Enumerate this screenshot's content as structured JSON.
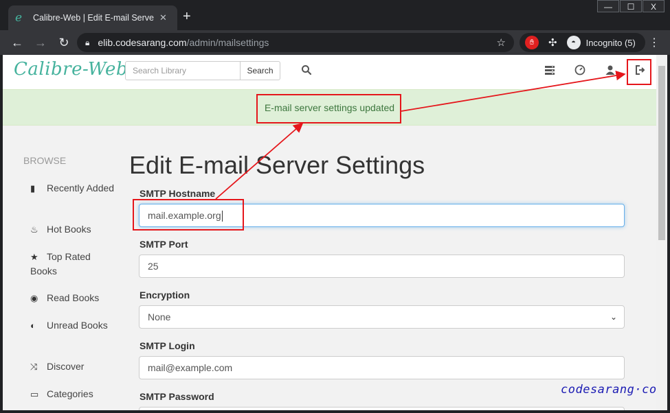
{
  "browser": {
    "tab_title": "Calibre-Web | Edit E-mail Server S",
    "tab_favicon": "e",
    "tab_close": "✕",
    "new_tab": "+",
    "url_host": "elib.codesarang.com",
    "url_path": "/admin/mailsettings",
    "incognito_label": "Incognito (5)",
    "window_controls": [
      "—",
      "☐",
      "X"
    ]
  },
  "navbar": {
    "brand": "Calibre-Web",
    "search_placeholder": "Search Library",
    "search_button": "Search",
    "icons": [
      "search-icon",
      "tasks-icon",
      "dashboard-icon",
      "user-icon",
      "logout-icon"
    ]
  },
  "alert": {
    "message": "E-mail server settings updated"
  },
  "sidebar": {
    "title": "BROWSE",
    "items": [
      {
        "label": "Recently Added",
        "icon": "book-icon",
        "glyph": "▮"
      },
      {
        "label": "Hot Books",
        "icon": "fire-icon",
        "glyph": "♨"
      },
      {
        "label": "Top Rated Books",
        "icon": "star-icon",
        "glyph": "★"
      },
      {
        "label": "Read Books",
        "icon": "eye-icon",
        "glyph": "◉"
      },
      {
        "label": "Unread Books",
        "icon": "eye-slash-icon",
        "glyph": "◐"
      },
      {
        "label": "Discover",
        "icon": "shuffle-icon",
        "glyph": "⤨"
      },
      {
        "label": "Categories",
        "icon": "inbox-icon",
        "glyph": "▭"
      }
    ]
  },
  "form": {
    "title": "Edit E-mail Server Settings",
    "smtp_hostname_label": "SMTP Hostname",
    "smtp_hostname_value": "mail.example.org",
    "smtp_port_label": "SMTP Port",
    "smtp_port_value": "25",
    "encryption_label": "Encryption",
    "encryption_value": "None",
    "smtp_login_label": "SMTP Login",
    "smtp_login_value": "mail@example.com",
    "smtp_password_label": "SMTP Password"
  },
  "watermark": "codesarang·com",
  "colors": {
    "brand": "#45b29d",
    "alert_bg": "#dff0d8",
    "alert_text": "#3c763d",
    "annotation": "#e5161b"
  }
}
